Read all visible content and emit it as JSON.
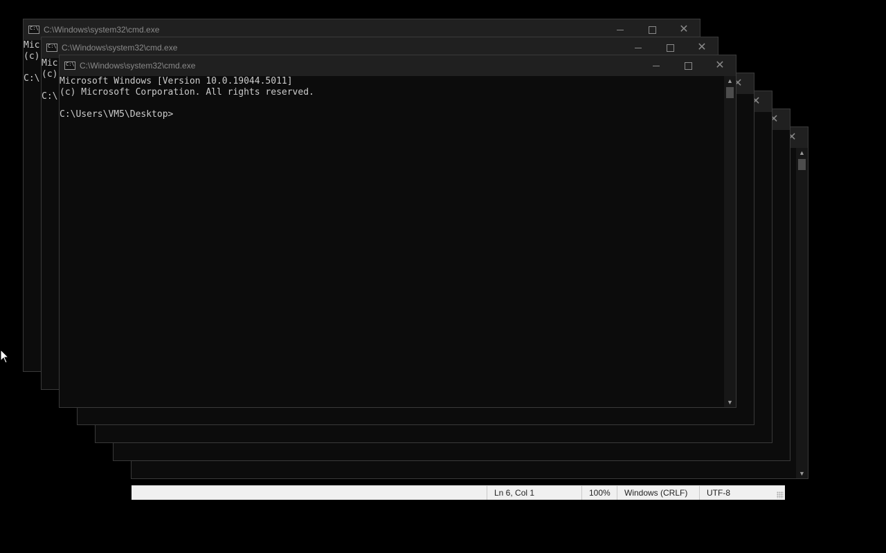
{
  "windows": {
    "back1": {
      "title": "C:\\Windows\\system32\\cmd.exe",
      "lines": [
        "Mic",
        "(c)",
        "",
        "C:\\"
      ]
    },
    "back2": {
      "title": "C:\\Windows\\system32\\cmd.exe",
      "lines": [
        "Mic",
        "(c)",
        "",
        "C:\\"
      ]
    },
    "front": {
      "title": "C:\\Windows\\system32\\cmd.exe",
      "lines": [
        "Microsoft Windows [Version 10.0.19044.5011]",
        "(c) Microsoft Corporation. All rights reserved.",
        "",
        "C:\\Users\\VM5\\Desktop>"
      ]
    }
  },
  "caption_buttons": {
    "minimize": "minimize-icon",
    "maximize": "maximize-icon",
    "close": "close-icon"
  },
  "statusbar": {
    "position": "Ln 6, Col 1",
    "zoom": "100%",
    "line_ending": "Windows (CRLF)",
    "encoding": "UTF-8"
  },
  "colors": {
    "console_bg": "#0c0c0c",
    "console_text": "#cccccc",
    "titlebar_bg": "#202020",
    "desktop_bg": "#000000"
  }
}
